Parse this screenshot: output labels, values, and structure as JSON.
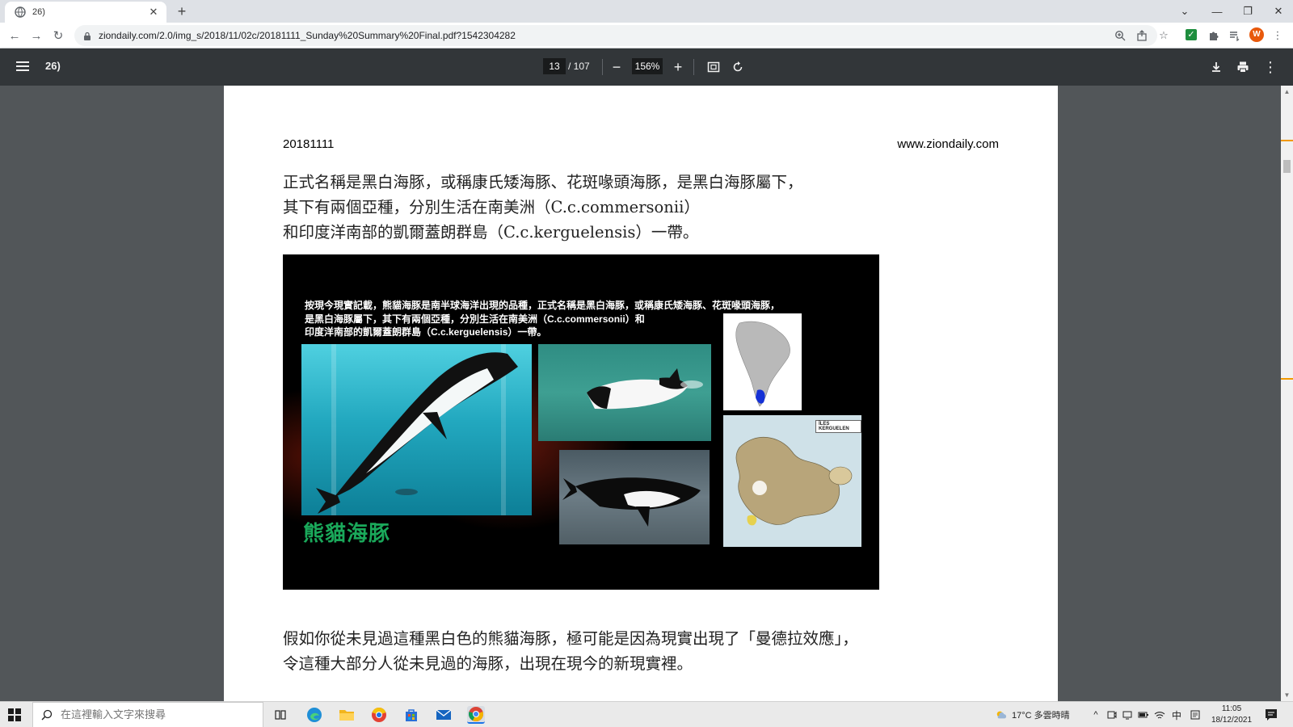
{
  "browser": {
    "tab_title": "26)",
    "url": "ziondaily.com/2.0/img_s/2018/11/02c/20181111_Sunday%20Summary%20Final.pdf?1542304282",
    "profile_initial": "W"
  },
  "pdf_toolbar": {
    "doc_title": "26)",
    "current_page": "13",
    "total_pages": "/ 107",
    "zoom": "156%"
  },
  "page": {
    "header_left": "20181111",
    "header_right": "www.ziondaily.com",
    "para1": [
      "正式名稱是黑白海豚，或稱康氏矮海豚、花斑喙頭海豚，是黑白海豚屬下，",
      "其下有兩個亞種，分別生活在南美洲（C.c.commersonii）",
      "和印度洋南部的凱爾蓋朗群島（C.c.kerguelensis）一帶。"
    ],
    "figure": {
      "caption": [
        "按現今現實記載，熊貓海豚是南半球海洋出現的品種，正式名稱是黑白海豚，或稱康氏矮海豚、花斑喙頭海豚，",
        "是黑白海豚屬下，其下有兩個亞種，分別生活在南美洲（C.c.commersonii）和",
        "印度洋南部的凱爾蓋朗群島（C.c.kerguelensis）一帶。"
      ],
      "title": "熊貓海豚",
      "map_label": "ÎLES KERGUELEN"
    },
    "para2": [
      "假如你從未見過這種黑白色的熊貓海豚，極可能是因為現實出現了「曼德拉效應」，",
      "令這種大部分人從未見過的海豚，出現在現今的新現實裡。"
    ]
  },
  "taskbar": {
    "search_placeholder": "在這裡輸入文字來搜尋",
    "weather": "17°C 多雲時晴",
    "ime": "中",
    "time": "11:05",
    "date": "18/12/2021"
  },
  "colors": {
    "pdf_toolbar": "#323639",
    "viewer_bg": "#525659",
    "figure_title": "#1aa85a",
    "chrome_active": "#1a73e8"
  }
}
